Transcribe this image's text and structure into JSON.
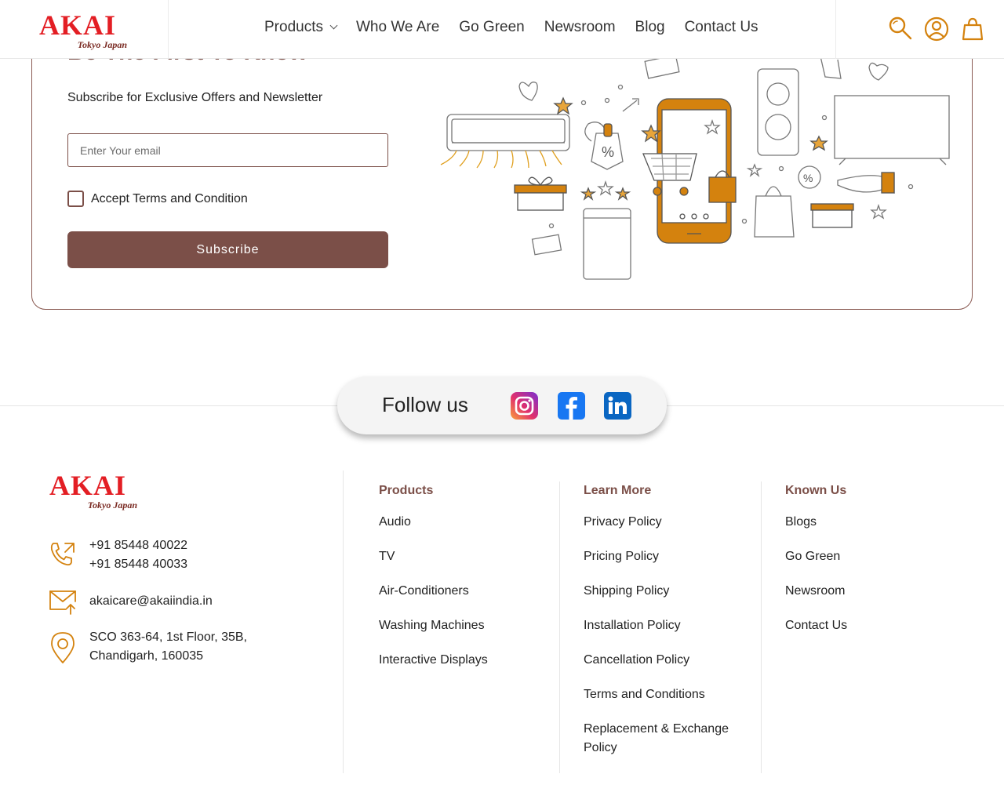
{
  "header": {
    "logo": {
      "brand": "AKAI",
      "tagline": "Tokyo Japan"
    },
    "nav": [
      "Products",
      "Who We Are",
      "Go Green",
      "Newsroom",
      "Blog",
      "Contact Us"
    ],
    "icons": [
      "search-icon",
      "account-icon",
      "cart-icon"
    ]
  },
  "subscribe": {
    "heading": "Be The First To Know",
    "subtitle": "Subscribe for Exclusive Offers and Newsletter",
    "email_placeholder": "Enter Your email",
    "terms_label": "Accept Terms and Condition",
    "button_label": "Subscribe"
  },
  "follow": {
    "label": "Follow us",
    "icons": [
      "instagram-icon",
      "facebook-icon",
      "linkedin-icon"
    ]
  },
  "footer": {
    "logo": {
      "brand": "AKAI",
      "tagline": "Tokyo Japan"
    },
    "phones": [
      "+91 85448 40022",
      "+91 85448 40033"
    ],
    "email": "akaicare@akaiindia.in",
    "address": [
      "SCO 363-64, 1st Floor, 35B,",
      "Chandigarh, 160035"
    ],
    "columns": [
      {
        "title": "Products",
        "links": [
          "Audio",
          "TV",
          "Air-Conditioners",
          "Washing Machines",
          "Interactive Displays"
        ]
      },
      {
        "title": "Learn More",
        "links": [
          "Privacy Policy",
          "Pricing Policy",
          "Shipping Policy",
          "Installation Policy",
          "Cancellation Policy",
          "Terms and Conditions",
          "Replacement & Exchange",
          "Policy"
        ]
      },
      {
        "title": "Known Us",
        "links": [
          "Blogs",
          "Go Green",
          "Newsroom",
          "Contact Us"
        ]
      }
    ]
  },
  "colors": {
    "brand_red": "#e31e24",
    "accent_brown": "#7b4f48",
    "icon_orange": "#d4820e"
  }
}
